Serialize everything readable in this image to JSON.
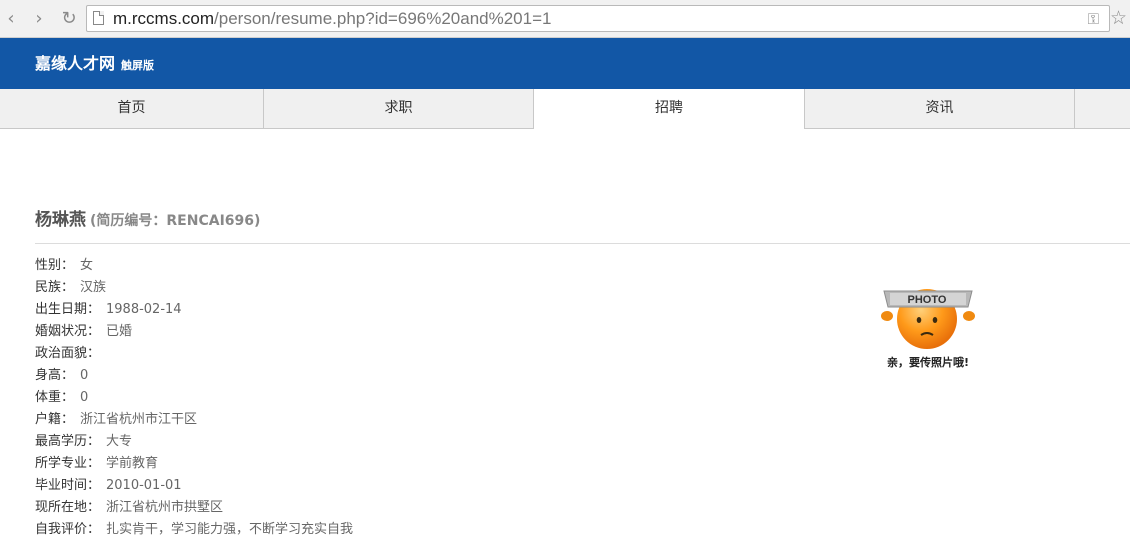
{
  "browser": {
    "url_host": "m.rccms.com",
    "url_path": "/person/resume.php?id=696%20and%201=1"
  },
  "site": {
    "title": "嘉缘人才网",
    "subtitle": "触屏版",
    "brand_color": "#1257a6"
  },
  "tabs": [
    {
      "label": "首页"
    },
    {
      "label": "求职"
    },
    {
      "label": "招聘"
    },
    {
      "label": "资讯"
    }
  ],
  "resume": {
    "name": "杨琳燕",
    "id_text": "(简历编号：RENCAI696)",
    "fields": [
      {
        "label": "性别：",
        "value": "女"
      },
      {
        "label": "民族：",
        "value": "汉族"
      },
      {
        "label": "出生日期：",
        "value": "1988-02-14"
      },
      {
        "label": "婚姻状况：",
        "value": "已婚"
      },
      {
        "label": "政治面貌：",
        "value": ""
      },
      {
        "label": "身高：",
        "value": "0"
      },
      {
        "label": "体重：",
        "value": "0"
      },
      {
        "label": "户籍：",
        "value": "浙江省杭州市江干区"
      },
      {
        "label": "最高学历：",
        "value": "大专"
      },
      {
        "label": "所学专业：",
        "value": "学前教育"
      },
      {
        "label": "毕业时间：",
        "value": "2010-01-01"
      },
      {
        "label": "现所在地：",
        "value": "浙江省杭州市拱墅区"
      },
      {
        "label": "自我评价：",
        "value": "扎实肯干，学习能力强，不断学习充实自我"
      }
    ],
    "photo": {
      "banner_text": "PHOTO",
      "caption": "亲，要传照片哦!"
    }
  }
}
